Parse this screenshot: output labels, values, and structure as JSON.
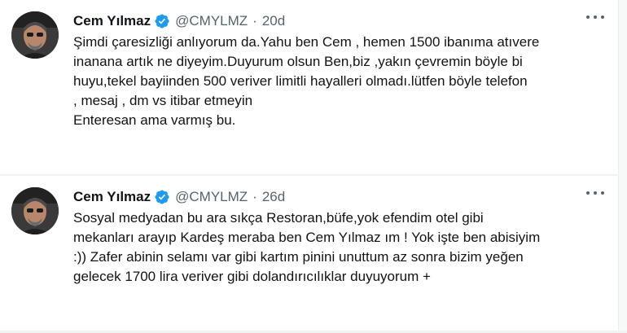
{
  "tweets": [
    {
      "author_name": "Cem Yılmaz",
      "handle": "@CMYLMZ",
      "separator": "·",
      "time": "20d",
      "lines": [
        "Şimdi çaresizliği anlıyorum da.Yahu ben Cem , hemen 1500 ibanıma atıvere",
        "inanana artık ne diyeyim.Duyurum olsun Ben,biz ,yakın çevremin böyle bi",
        "huyu,tekel bayiinden 500 veriver limitli hayalleri olmadı.lütfen böyle telefon",
        ", mesaj , dm  vs itibar etmeyin",
        "Enteresan ama varmış bu."
      ]
    },
    {
      "author_name": "Cem Yılmaz",
      "handle": "@CMYLMZ",
      "separator": "·",
      "time": "26d",
      "lines": [
        "Sosyal medyadan bu ara sıkça Restoran,büfe,yok efendim otel gibi",
        "mekanları arayıp Kardeş meraba ben Cem Yılmaz ım ! Yok işte ben abisiyim",
        ":)) Zafer abinin selamı var gibi kartım pinini unuttum az sonra bizim yeğen",
        "gelecek 1700 lira veriver gibi dolandırıcılıklar  duyuyorum +"
      ]
    }
  ],
  "colors": {
    "verified": "#1d9bf0",
    "text": "#0f1419",
    "secondary": "#536471",
    "divider": "#eff3f4"
  }
}
